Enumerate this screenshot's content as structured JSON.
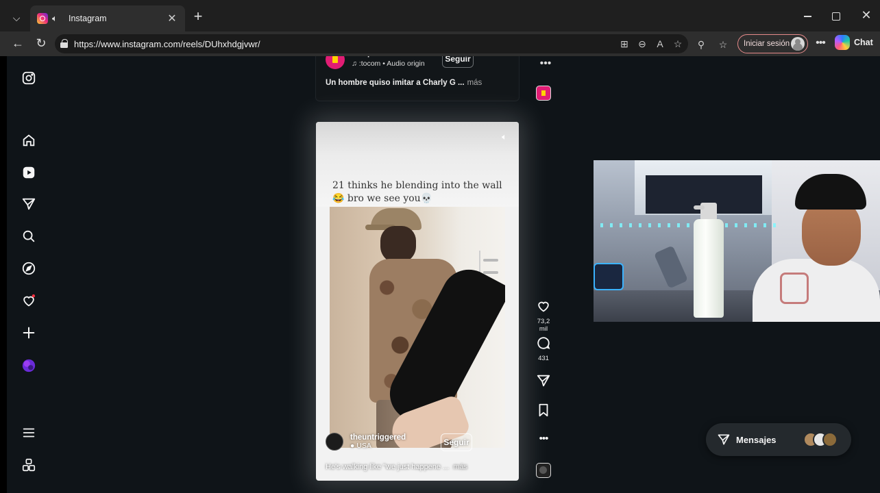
{
  "browser": {
    "tab": {
      "title": "Instagram",
      "favicon": "instagram-icon",
      "audio_icon": "speaker-icon"
    },
    "url": "https://www.instagram.com/reels/DUhxhdgjvwr/",
    "signin_label": "Iniciar sesión",
    "copilot_label": "Chat",
    "colors": {
      "titlebar": "#1f1f1f",
      "toolbar": "#2e2e2e",
      "signin_border": "#e78b8b"
    }
  },
  "sidebar": {
    "items": [
      {
        "name": "instagram-logo-icon"
      },
      {
        "name": "home-icon"
      },
      {
        "name": "reels-icon"
      },
      {
        "name": "direct-icon"
      },
      {
        "name": "search-icon"
      },
      {
        "name": "explore-icon"
      },
      {
        "name": "notifications-icon"
      },
      {
        "name": "create-icon"
      },
      {
        "name": "profile-avatar"
      },
      {
        "name": "menu-icon"
      },
      {
        "name": "more-apps-icon"
      }
    ]
  },
  "previous_reel": {
    "username": "elimpactocom",
    "audio": "♫ :tocom • Audio origin",
    "follow_label": "Seguir",
    "caption": "Un hombre quiso imitar a Charly G ...",
    "more_label": "más"
  },
  "reel": {
    "overlay_text": "21 thinks he blending into the wall😂 bro we see you💀",
    "username": "theuntriggered",
    "location": "● USA",
    "follow_label": "Seguir",
    "caption": "He's walking like \"we just happene ...",
    "more_label": "más",
    "likes": "73,2 mil",
    "comments": "431"
  },
  "messages": {
    "label": "Mensajes"
  },
  "colors": {
    "page_bg": "#0f1418",
    "accent_red": "#ff3040"
  }
}
